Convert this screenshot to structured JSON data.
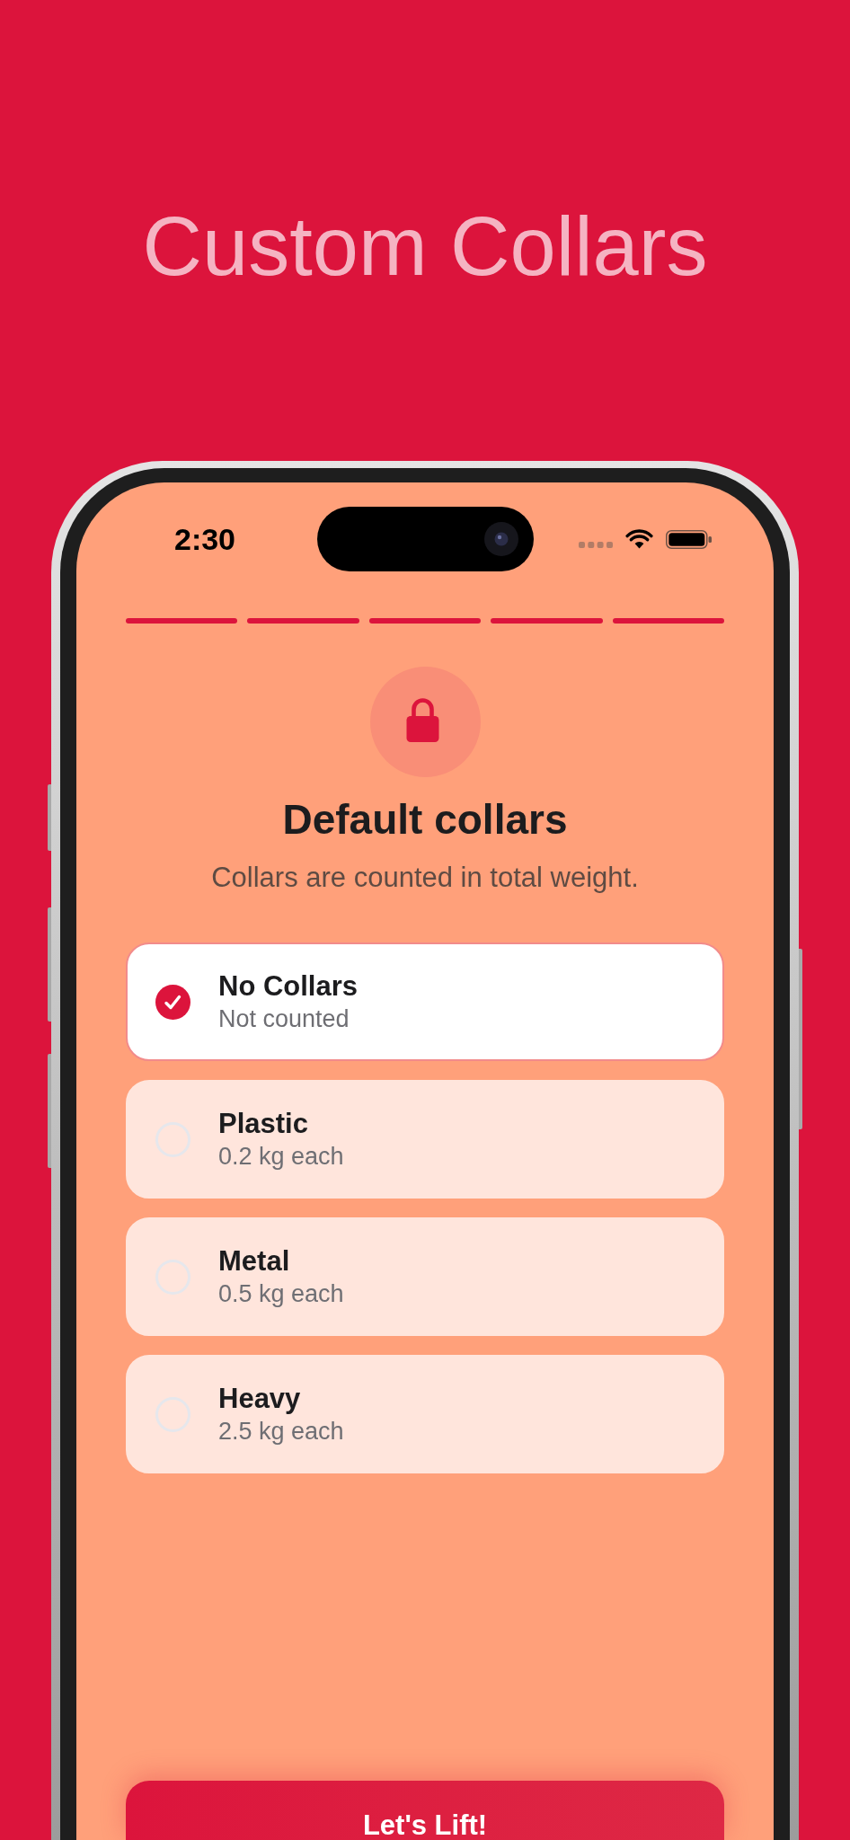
{
  "hero_title": "Custom Collars",
  "status_bar": {
    "time": "2:30"
  },
  "progress_steps": [
    {
      "completed": true
    },
    {
      "completed": true
    },
    {
      "completed": true
    },
    {
      "completed": true
    },
    {
      "completed": true
    }
  ],
  "header": {
    "title": "Default collars",
    "subtitle": "Collars are counted in total weight."
  },
  "options": [
    {
      "label": "No Collars",
      "detail": "Not counted",
      "selected": true
    },
    {
      "label": "Plastic",
      "detail": "0.2 kg each",
      "selected": false
    },
    {
      "label": "Metal",
      "detail": "0.5 kg each",
      "selected": false
    },
    {
      "label": "Heavy",
      "detail": "2.5 kg each",
      "selected": false
    }
  ],
  "primary_button": {
    "label": "Let's Lift!"
  }
}
